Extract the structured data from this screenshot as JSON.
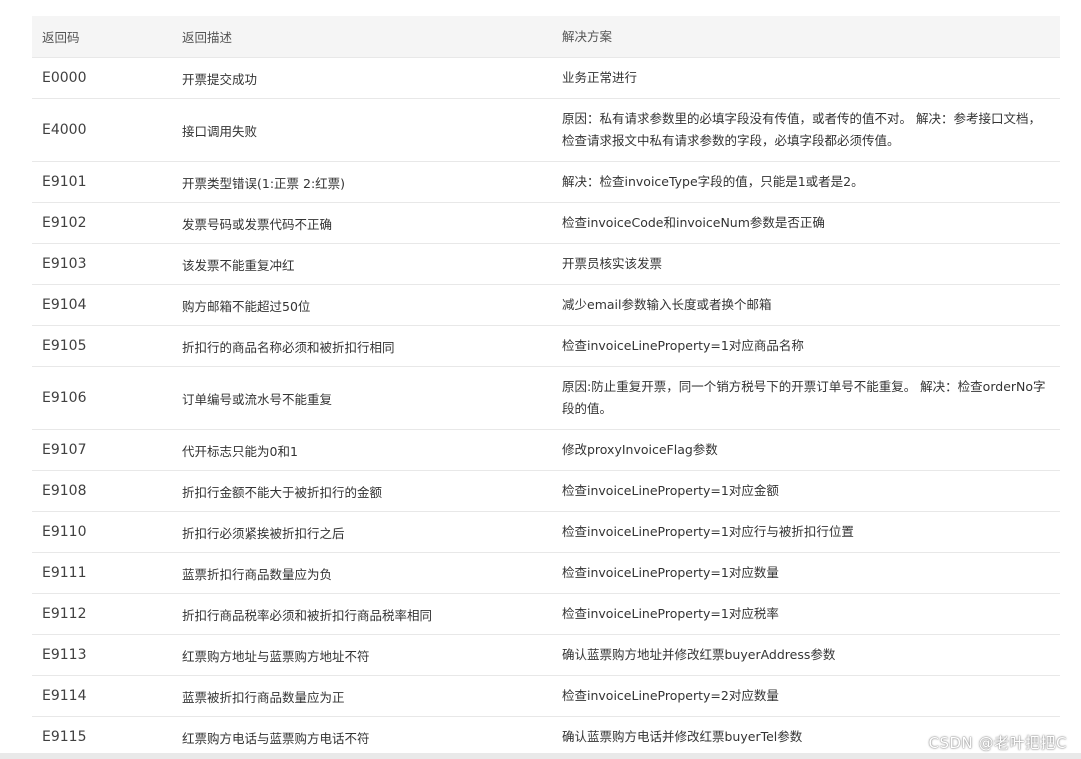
{
  "header": {
    "code": "返回码",
    "desc": "返回描述",
    "solution": "解决方案"
  },
  "rows": [
    {
      "code": "E0000",
      "desc": "开票提交成功",
      "solution": "业务正常进行"
    },
    {
      "code": "E4000",
      "desc": "接口调用失败",
      "solution": "原因：私有请求参数里的必填字段没有传值，或者传的值不对。 解决：参考接口文档，检查请求报文中私有请求参数的字段，必填字段都必须传值。"
    },
    {
      "code": "E9101",
      "desc": "开票类型错误(1:正票 2:红票)",
      "solution": "解决：检查invoiceType字段的值，只能是1或者是2。"
    },
    {
      "code": "E9102",
      "desc": "发票号码或发票代码不正确",
      "solution": "检查invoiceCode和invoiceNum参数是否正确"
    },
    {
      "code": "E9103",
      "desc": "该发票不能重复冲红",
      "solution": "开票员核实该发票"
    },
    {
      "code": "E9104",
      "desc": "购方邮箱不能超过50位",
      "solution": "减少email参数输入长度或者换个邮箱"
    },
    {
      "code": "E9105",
      "desc": "折扣行的商品名称必须和被折扣行相同",
      "solution": "检查invoiceLineProperty=1对应商品名称"
    },
    {
      "code": "E9106",
      "desc": "订单编号或流水号不能重复",
      "solution": "原因:防止重复开票，同一个销方税号下的开票订单号不能重复。 解决：检查orderNo字段的值。"
    },
    {
      "code": "E9107",
      "desc": "代开标志只能为0和1",
      "solution": "修改proxyInvoiceFlag参数"
    },
    {
      "code": "E9108",
      "desc": "折扣行金额不能大于被折扣行的金额",
      "solution": "检查invoiceLineProperty=1对应金额"
    },
    {
      "code": "E9110",
      "desc": "折扣行必须紧挨被折扣行之后",
      "solution": "检查invoiceLineProperty=1对应行与被折扣行位置"
    },
    {
      "code": "E9111",
      "desc": "蓝票折扣行商品数量应为负",
      "solution": "检查invoiceLineProperty=1对应数量"
    },
    {
      "code": "E9112",
      "desc": "折扣行商品税率必须和被折扣行商品税率相同",
      "solution": "检查invoiceLineProperty=1对应税率"
    },
    {
      "code": "E9113",
      "desc": "红票购方地址与蓝票购方地址不符",
      "solution": "确认蓝票购方地址并修改红票buyerAddress参数"
    },
    {
      "code": "E9114",
      "desc": "蓝票被折扣行商品数量应为正",
      "solution": "检查invoiceLineProperty=2对应数量"
    },
    {
      "code": "E9115",
      "desc": "红票购方电话与蓝票购方电话不符",
      "solution": "确认蓝票购方电话并修改红票buyerTel参数"
    }
  ],
  "watermark": "CSDN @老叶把把C"
}
